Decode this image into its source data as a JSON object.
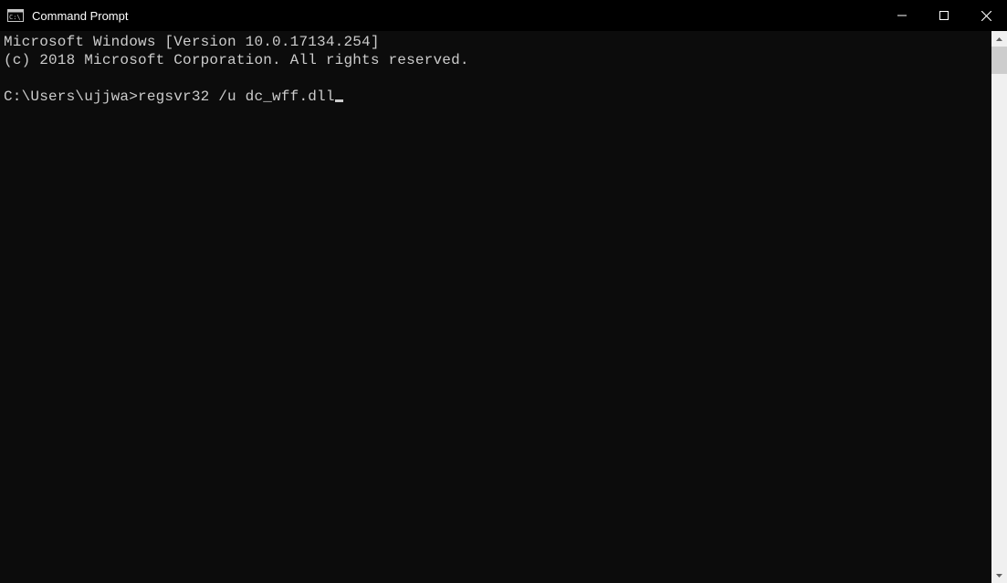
{
  "titlebar": {
    "title": "Command Prompt"
  },
  "terminal": {
    "line1": "Microsoft Windows [Version 10.0.17134.254]",
    "line2": "(c) 2018 Microsoft Corporation. All rights reserved.",
    "blank": "",
    "prompt": "C:\\Users\\ujjwa>",
    "command": "regsvr32 /u dc_wff.dll"
  }
}
